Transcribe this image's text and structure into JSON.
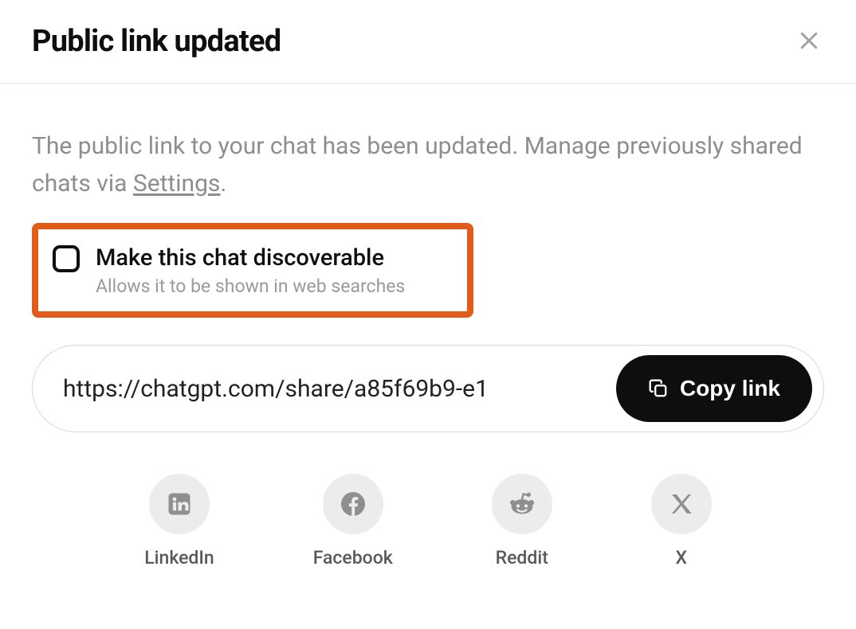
{
  "header": {
    "title": "Public link updated"
  },
  "body": {
    "description_prefix": "The public link to your chat has been updated. Manage previously shared chats via ",
    "settings_link_text": "Settings",
    "description_suffix": "."
  },
  "discoverable": {
    "checked": false,
    "title": "Make this chat discoverable",
    "subtitle": "Allows it to be shown in web searches"
  },
  "link": {
    "url": "https://chatgpt.com/share/a85f69b9-e1",
    "copy_label": "Copy link"
  },
  "share": [
    {
      "id": "linkedin",
      "label": "LinkedIn"
    },
    {
      "id": "facebook",
      "label": "Facebook"
    },
    {
      "id": "reddit",
      "label": "Reddit"
    },
    {
      "id": "x",
      "label": "X"
    }
  ]
}
